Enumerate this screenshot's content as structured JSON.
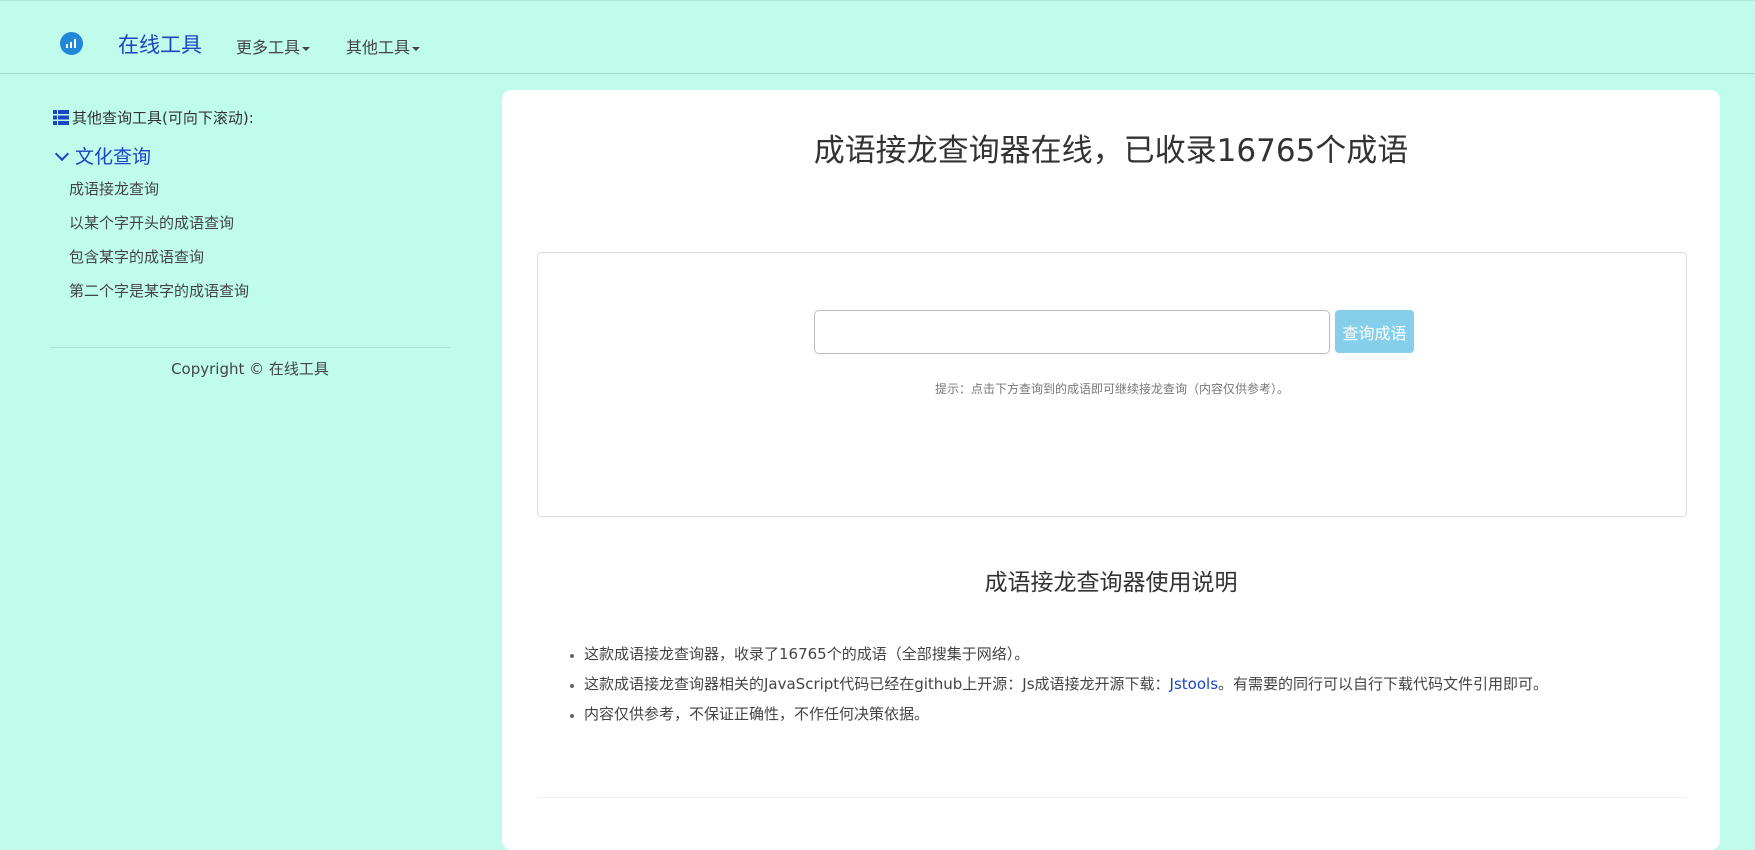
{
  "navbar": {
    "brand": "在线工具",
    "menu": [
      {
        "label": "更多工具"
      },
      {
        "label": "其他工具"
      }
    ]
  },
  "sidebar": {
    "heading": "其他查询工具(可向下滚动):",
    "category": "文化查询",
    "links": [
      "成语接龙查询",
      "以某个字开头的成语查询",
      "包含某字的成语查询",
      "第二个字是某字的成语查询"
    ],
    "copyright": "Copyright © 在线工具"
  },
  "main": {
    "title": "成语接龙查询器在线，已收录16765个成语",
    "search": {
      "value": "",
      "placeholder": "",
      "button": "查询成语"
    },
    "hint": "提示：点击下方查询到的成语即可继续接龙查询（内容仅供参考）。",
    "section_title": "成语接龙查询器使用说明",
    "notes": {
      "item1": "这款成语接龙查询器，收录了16765个的成语（全部搜集于网络）。",
      "item2_prefix": "这款成语接龙查询器相关的JavaScript代码已经在github上开源：Js成语接龙开源下载：",
      "item2_link": "Jstools",
      "item2_suffix": "。有需要的同行可以自行下载代码文件引用即可。",
      "item3": "内容仅供参考，不保证正确性，不作任何决策依据。"
    }
  },
  "colors": {
    "background": "#c0fcec",
    "brand": "#1a46c2",
    "button": "#86cfeb",
    "card": "#ffffff"
  },
  "icons": {
    "logo": "chart-logo-icon",
    "sidebar_heading": "list-icon",
    "category": "chevron-down-icon",
    "dropdown": "caret-down-icon"
  }
}
